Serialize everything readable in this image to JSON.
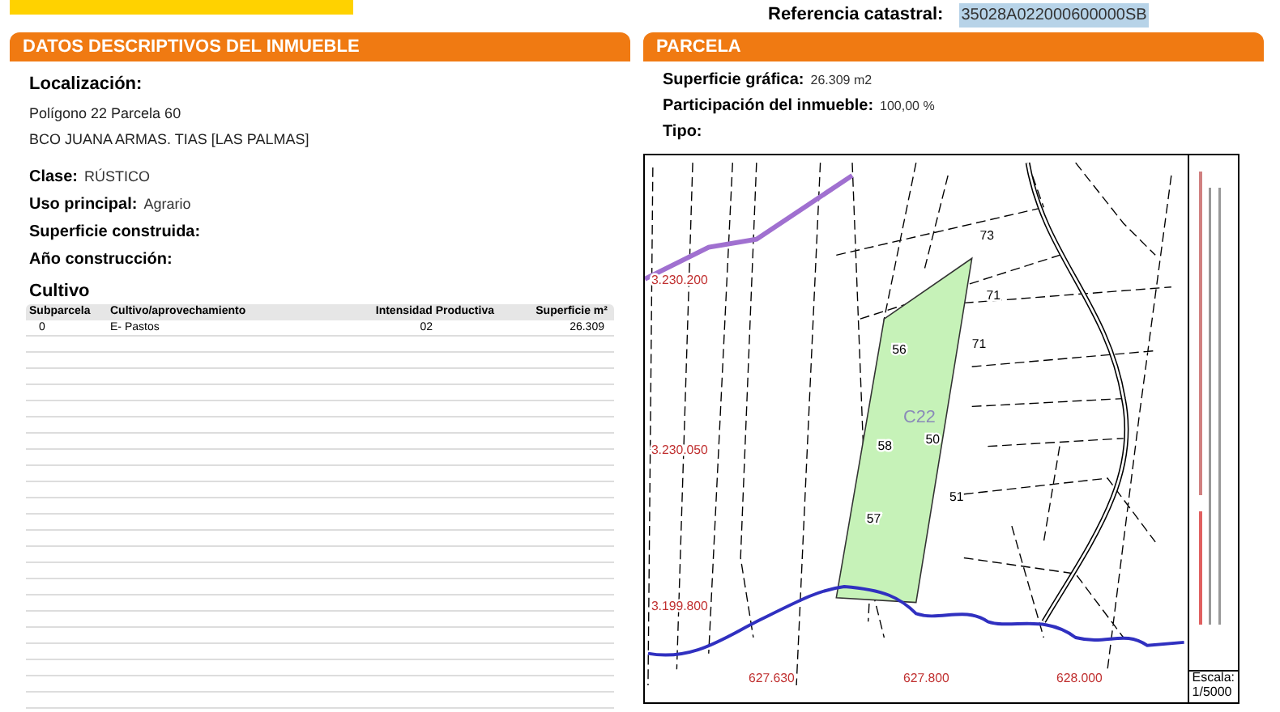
{
  "header": {
    "reference_label": "Referencia catastral:",
    "reference_value": "35028A022000600000SB"
  },
  "left_panel": {
    "title": "DATOS DESCRIPTIVOS DEL **INMUEBLE**",
    "location_label": "Localización:",
    "location_lines": [
      "Polígono 22 Parcela 60",
      "BCO JUANA ARMAS. TIAS [LAS PALMAS]"
    ],
    "fields": [
      {
        "label": "Clase:",
        "value": "RÚSTICO"
      },
      {
        "label": "Uso principal:",
        "value": "Agrario"
      },
      {
        "label": "Superficie construida:"
      },
      {
        "label": "Año construcción:"
      }
    ],
    "cultivo": {
      "title": "Cultivo",
      "columns": [
        "Subparcela",
        "Cultivo/aprovechamiento",
        "Intensidad Productiva",
        "Superficie m²"
      ],
      "rows": [
        [
          "0",
          "E- Pastos",
          "02",
          "26.309"
        ]
      ]
    }
  },
  "right_panel": {
    "title": "PARCELA",
    "fields": [
      {
        "label": "Superficie gráfica:",
        "value": "26.309 m2"
      },
      {
        "label": "Participación del inmueble:",
        "value": "100,00 %"
      },
      {
        "label": "Tipo:"
      }
    ],
    "map": {
      "parcel_labels": [
        "73",
        "71",
        "56",
        "71",
        "58",
        "50",
        "51",
        "57"
      ],
      "highlight_label": "C22",
      "y_coords": [
        "3.230.200",
        "3.230.050",
        "3.199.800"
      ],
      "x_coords": [
        "627.630",
        "627.800",
        "628.000"
      ],
      "scale_label": "Escala:",
      "scale_value": "1/5000"
    }
  }
}
